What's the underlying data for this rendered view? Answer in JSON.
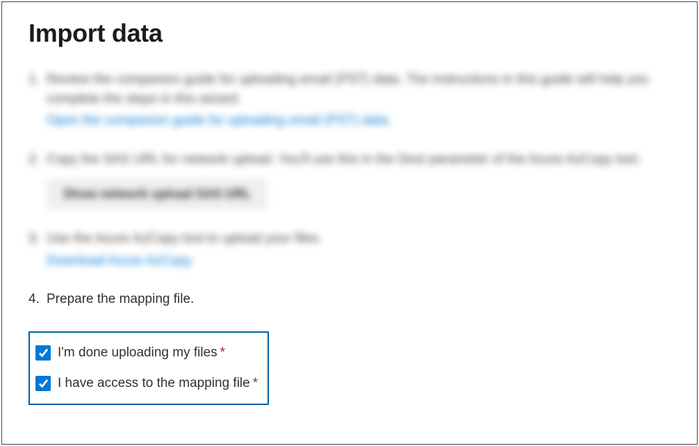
{
  "title": "Import data",
  "steps": [
    {
      "text": "Review the companion guide for uploading email (PST) data. The instructions in this guide will help you complete the steps in this wizard.",
      "link": "Open the companion guide for uploading email (PST) data."
    },
    {
      "text": "Copy the SAS URL for network upload. You'll use this in the Dest parameter of the Azure AzCopy tool.",
      "button": "Show network upload SAS URL"
    },
    {
      "text": "Use the Azure AzCopy tool to upload your files.",
      "link": "Download Azure AzCopy"
    },
    {
      "text": "Prepare the mapping file."
    }
  ],
  "checkboxes": {
    "done_uploading": {
      "label": "I'm done uploading my files",
      "checked": true,
      "required": true
    },
    "have_mapping": {
      "label": "I have access to the mapping file",
      "checked": true,
      "required": true
    }
  },
  "required_marker": "*"
}
